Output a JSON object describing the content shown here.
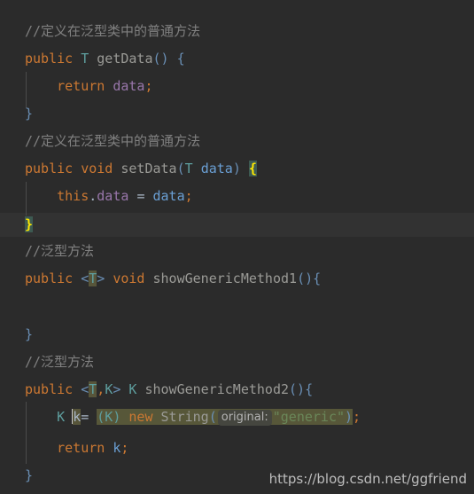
{
  "editor": {
    "theme_name": "darcula",
    "background_color": "#2b2b2b",
    "current_line_color": "#323232",
    "selection_color": "#575739",
    "bracket_match_color": "#3d5a52",
    "identifier_highlight_color": "#57553a",
    "indent_guide_color": "#4b4b4b",
    "language": "java"
  },
  "lines": [
    {
      "n": 1,
      "text": "//定义在泛型类中的普通方法"
    },
    {
      "n": 2,
      "text": "public T getData() {"
    },
    {
      "n": 3,
      "text": "    return data;"
    },
    {
      "n": 4,
      "text": "}"
    },
    {
      "n": 5,
      "text": "//定义在泛型类中的普通方法"
    },
    {
      "n": 6,
      "text": "public void setData(T data) {"
    },
    {
      "n": 7,
      "text": "    this.data = data;"
    },
    {
      "n": 8,
      "text": "}"
    },
    {
      "n": 9,
      "text": "//泛型方法"
    },
    {
      "n": 10,
      "text": "public <T> void showGenericMethod1(){"
    },
    {
      "n": 11,
      "text": ""
    },
    {
      "n": 12,
      "text": "}"
    },
    {
      "n": 13,
      "text": "//泛型方法"
    },
    {
      "n": 14,
      "text": "public <T,K> K showGenericMethod2(){"
    },
    {
      "n": 15,
      "text": "    K k= (K) new String( original: \"generic\");"
    },
    {
      "n": 16,
      "text": "    return k;"
    },
    {
      "n": 17,
      "text": "}"
    }
  ],
  "tokens": {
    "comment_generic_class_method": "//定义在泛型类中的普通方法",
    "comment_generic_method": "//泛型方法",
    "kw_public": "public",
    "kw_void": "void",
    "kw_return": "return",
    "kw_this": "this",
    "kw_new": "new",
    "type_T": "T",
    "type_K": "K",
    "type_String": "String",
    "method_getData": "getData",
    "method_setData": "setData",
    "method_showGenericMethod1": "showGenericMethod1",
    "method_showGenericMethod2": "showGenericMethod2",
    "field_data": "data",
    "param_data": "data",
    "var_k": "k",
    "string_generic": "\"generic\"",
    "paren_open": "(",
    "paren_close": ")",
    "parens_empty": "()",
    "brace_open": "{",
    "brace_close": "}",
    "angle_open": "<",
    "angle_close": ">",
    "comma": ",",
    "semicolon": ";",
    "dot": ".",
    "assign": "=",
    "assign_tight": "=",
    "space": " ",
    "indent": "    ",
    "cast_K": "(K)",
    "generic_T_open": "<",
    "generic_T_close": ">"
  },
  "inline_hint": {
    "label": "original:"
  },
  "watermark": {
    "url": "https://blog.csdn.net/ggfriend"
  }
}
